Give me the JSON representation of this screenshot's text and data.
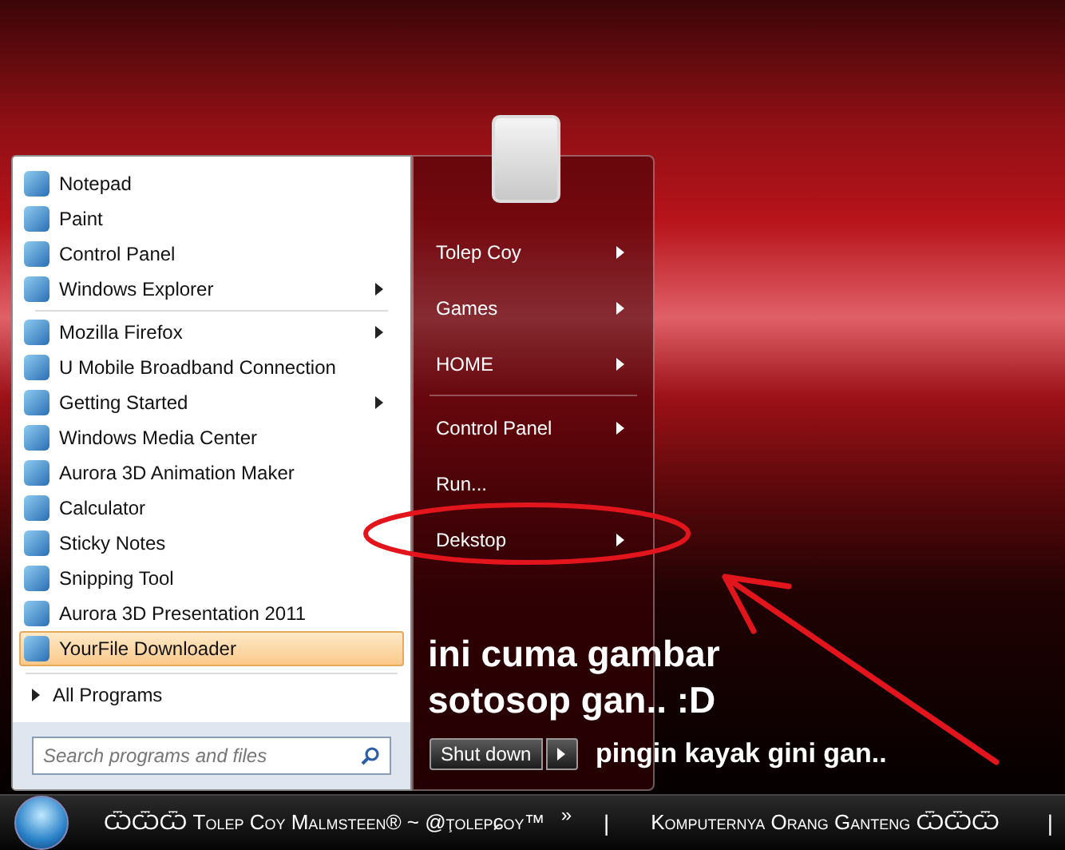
{
  "start_menu": {
    "programs": [
      {
        "label": "Notepad",
        "submenu": false,
        "selected": false
      },
      {
        "label": "Paint",
        "submenu": false,
        "selected": false
      },
      {
        "label": "Control Panel",
        "submenu": false,
        "selected": false
      },
      {
        "label": "Windows Explorer",
        "submenu": true,
        "selected": false
      },
      {
        "label": "Mozilla Firefox",
        "submenu": true,
        "selected": false
      },
      {
        "label": "U Mobile Broadband Connection",
        "submenu": false,
        "selected": false
      },
      {
        "label": "Getting Started",
        "submenu": true,
        "selected": false
      },
      {
        "label": "Windows Media Center",
        "submenu": false,
        "selected": false
      },
      {
        "label": "Aurora 3D Animation Maker",
        "submenu": false,
        "selected": false
      },
      {
        "label": "Calculator",
        "submenu": false,
        "selected": false
      },
      {
        "label": "Sticky Notes",
        "submenu": false,
        "selected": false
      },
      {
        "label": "Snipping Tool",
        "submenu": false,
        "selected": false
      },
      {
        "label": "Aurora 3D Presentation 2011",
        "submenu": false,
        "selected": false
      },
      {
        "label": "YourFile Downloader",
        "submenu": false,
        "selected": true
      }
    ],
    "all_programs": "All Programs",
    "search": {
      "placeholder": "Search programs and files"
    },
    "places": [
      {
        "label": "Tolep Coy",
        "submenu": true
      },
      {
        "label": "Games",
        "submenu": true
      },
      {
        "label": "HOME",
        "submenu": true
      },
      {
        "label": "Control Panel",
        "submenu": true
      },
      {
        "label": "Run...",
        "submenu": false
      },
      {
        "label": "Dekstop",
        "submenu": true
      }
    ],
    "shutdown": "Shut down"
  },
  "annotations": {
    "caption": [
      "ini cuma gambar",
      "sotosop gan.. :D"
    ],
    "note": "pingin kayak gini gan.."
  },
  "taskbar": {
    "toolbar_text": "ѾѾѾ Tolep Coy Malmsteen® ~ @ţolepɕoy™",
    "chevron": "»",
    "separator_1": "|",
    "title": "Komputernya Orang Ganteng ѾѾѾ",
    "separator_2": "|"
  }
}
